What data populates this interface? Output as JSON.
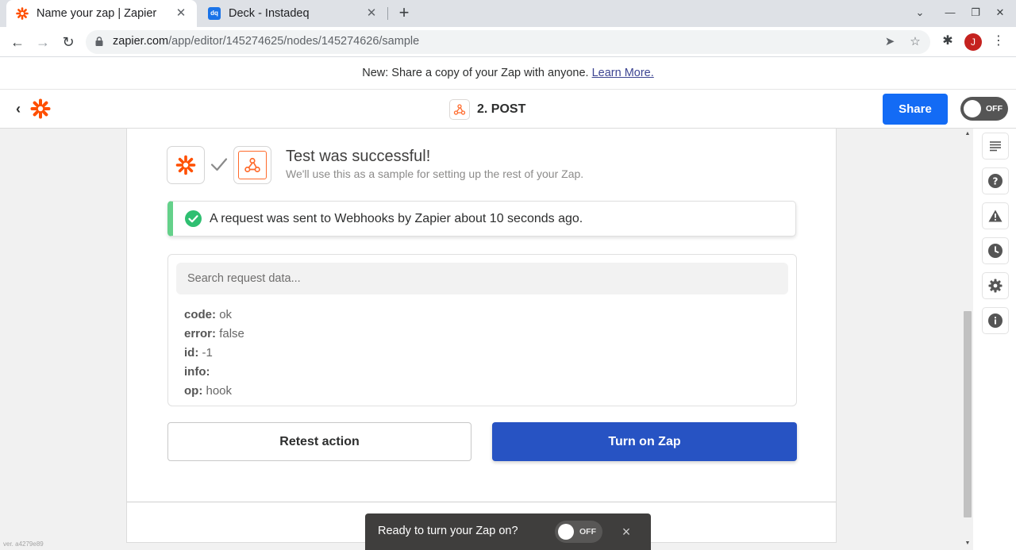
{
  "browser": {
    "tabs": [
      {
        "title": "Name your zap | Zapier",
        "favicon": "zapier-asterisk-icon",
        "active": true
      },
      {
        "title": "Deck - Instadeq",
        "favicon": "instadeq-icon",
        "active": false
      }
    ],
    "favicon_dq": "dq",
    "url_host": "zapier.com",
    "url_path": "/app/editor/145274625/nodes/145274626/sample",
    "avatar_letter": "J",
    "avatar_color": "#c5221f"
  },
  "announcement": {
    "text": "New: Share a copy of your Zap with anyone.",
    "link": "Learn More."
  },
  "header": {
    "step_title": "2. POST",
    "share_label": "Share",
    "toggle_label": "OFF",
    "accent": "#136bf5"
  },
  "test": {
    "title": "Test was successful!",
    "subtitle": "We'll use this as a sample for setting up the rest of your Zap.",
    "alert_message": "A request was sent to Webhooks by Zapier about 10 seconds ago.",
    "success_color": "#64d18a"
  },
  "request_data": {
    "search_placeholder": "Search request data...",
    "fields": [
      {
        "key": "code:",
        "value": "ok"
      },
      {
        "key": "error:",
        "value": "false"
      },
      {
        "key": "id:",
        "value": "-1"
      },
      {
        "key": "info:",
        "value": ""
      },
      {
        "key": "op:",
        "value": "hook"
      }
    ]
  },
  "actions": {
    "retest_label": "Retest action",
    "turn_on_label": "Turn on Zap",
    "turn_on_color": "#2753c3"
  },
  "version": "ver. a4279e89",
  "toast": {
    "text": "Ready to turn your Zap on?",
    "toggle_label": "OFF"
  },
  "sidebar": {
    "icons": [
      "details-icon",
      "help-icon",
      "warning-icon",
      "history-icon",
      "settings-icon",
      "info-icon"
    ]
  }
}
